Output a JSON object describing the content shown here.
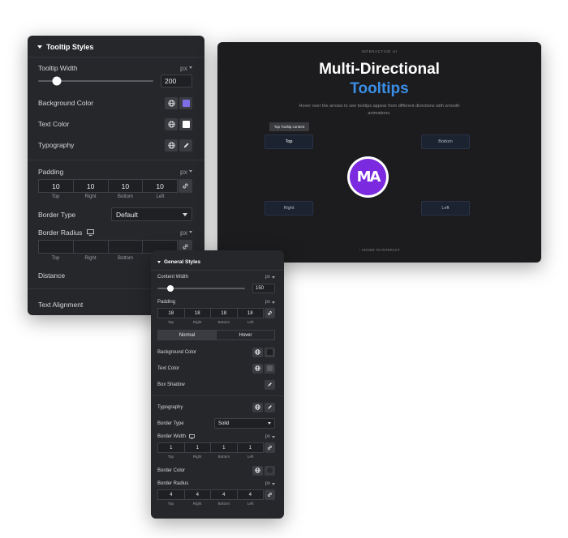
{
  "tooltip_panel": {
    "title": "Tooltip Styles",
    "width": {
      "label": "Tooltip Width",
      "unit": "px",
      "value": "200",
      "slider_fraction": 0.16
    },
    "background_color": {
      "label": "Background Color",
      "swatch": "#7e6ee6"
    },
    "text_color": {
      "label": "Text Color",
      "swatch": "#ffffff"
    },
    "typography": {
      "label": "Typography"
    },
    "padding": {
      "label": "Padding",
      "unit": "px",
      "values": [
        "10",
        "10",
        "10",
        "10"
      ],
      "sides": [
        "Top",
        "Right",
        "Bottom",
        "Left"
      ]
    },
    "border_type": {
      "label": "Border Type",
      "value": "Default"
    },
    "border_radius": {
      "label": "Border Radius",
      "unit": "px",
      "values": [
        "",
        "",
        "",
        ""
      ],
      "sides": [
        "Top",
        "Right",
        "Bottom",
        "Left"
      ]
    },
    "distance": {
      "label": "Distance"
    },
    "text_alignment": {
      "label": "Text Alignment"
    }
  },
  "general_panel": {
    "title": "General Styles",
    "content_width": {
      "label": "Content Width",
      "unit": "px",
      "value": "150",
      "slider_fraction": 0.15
    },
    "padding": {
      "label": "Padding",
      "unit": "px",
      "values": [
        "18",
        "18",
        "18",
        "18"
      ],
      "sides": [
        "Top",
        "Right",
        "Bottom",
        "Left"
      ]
    },
    "tabs": [
      "Normal",
      "Hover"
    ],
    "background_color": {
      "label": "Background Color",
      "swatch": "#1f1f22"
    },
    "text_color": {
      "label": "Text Color",
      "swatch": "#5a5a60"
    },
    "box_shadow": {
      "label": "Box Shadow"
    },
    "typography": {
      "label": "Typography"
    },
    "border_type": {
      "label": "Border Type",
      "value": "Solid"
    },
    "border_width": {
      "label": "Border Width",
      "unit": "px",
      "values": [
        "1",
        "1",
        "1",
        "1"
      ],
      "sides": [
        "Top",
        "Right",
        "Bottom",
        "Left"
      ]
    },
    "border_color": {
      "label": "Border Color",
      "swatch": "#2a2a2e"
    },
    "border_radius": {
      "label": "Border Radius",
      "unit": "px",
      "values": [
        "4",
        "4",
        "4",
        "4"
      ],
      "sides": [
        "Top",
        "Right",
        "Bottom",
        "Left"
      ]
    }
  },
  "preview": {
    "eyebrow": "INTERACTIVE UI",
    "title_line1": "Multi-Directional",
    "title_line2": "Tooltips",
    "subtitle": "Hover over the arrows to see tooltips appear from different directions with smooth animations.",
    "tooltip_text": "Top Tooltip content",
    "buttons": {
      "top": "Top",
      "bottom": "Bottom",
      "right": "Right",
      "left": "Left"
    },
    "logo_text": "MA",
    "footer": "↑ HOVER TO INTERACT"
  },
  "colors": {
    "accent_blue": "#3b8ee6",
    "logo_purple": "#7b2ae0",
    "panel_bg": "#26272b",
    "preview_bg": "#1c1b1d"
  },
  "icons": [
    "globe-icon",
    "pencil-icon",
    "link-icon",
    "desktop-icon"
  ]
}
